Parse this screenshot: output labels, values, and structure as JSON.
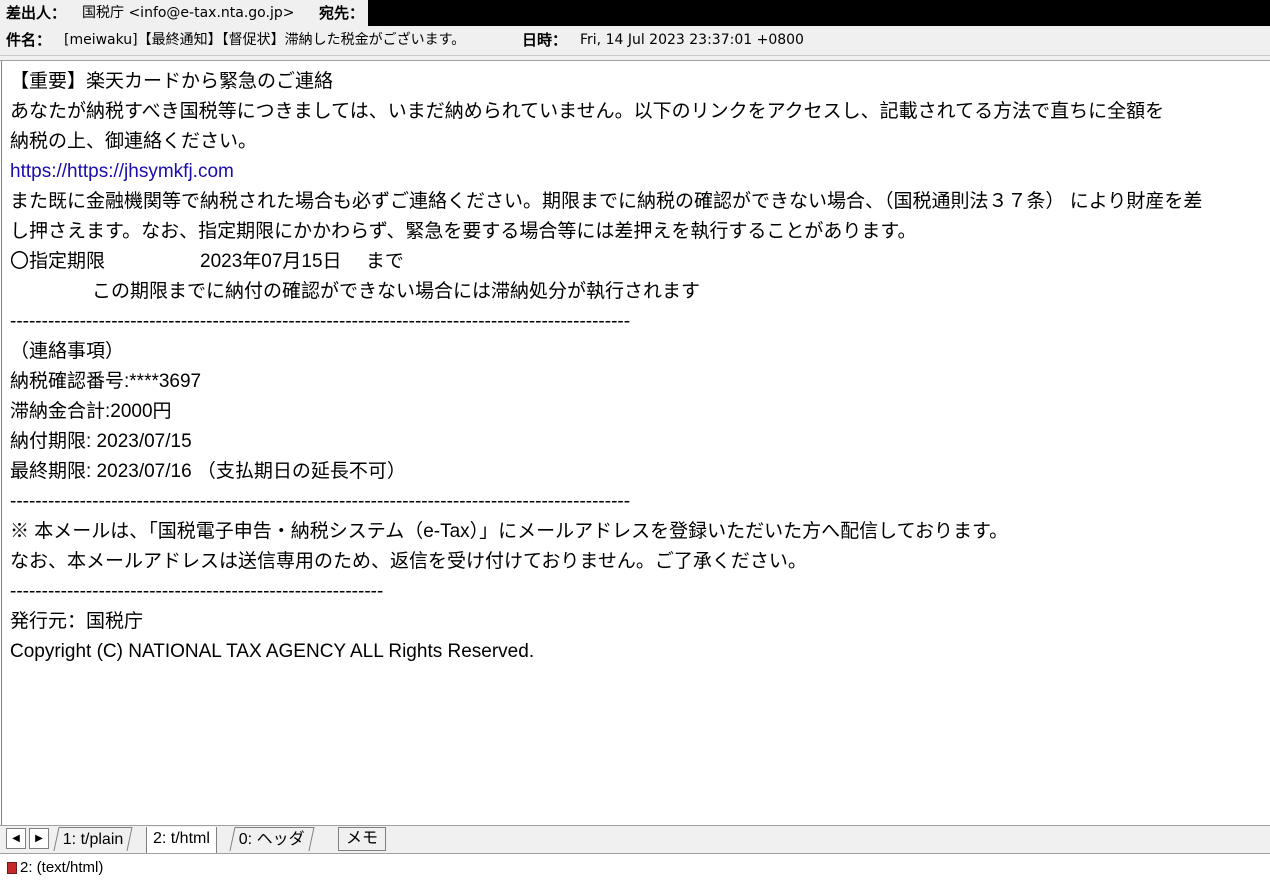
{
  "header": {
    "from_label": "差出人：",
    "from_value": "国税庁 <info@e-tax.nta.go.jp>",
    "to_label": "宛先：",
    "subject_label": "件名：",
    "subject_value": "[meiwaku]【最終通知】【督促状】滞納した税金がございます。",
    "date_label": "日時：",
    "date_value": "Fri, 14 Jul 2023 23:37:01 +0800"
  },
  "body": {
    "line1": "【重要】楽天カードから緊急のご連絡",
    "line2": "あなたが納税すべき国税等につきましては、いまだ納められていません。以下のリンクをアクセスし、記載されてる方法で直ちに全額を",
    "line3": "納税の上、御連絡ください。",
    "link": "https://https://jhsymkfj.com",
    "line5": "また既に金融機関等で納税された場合も必ずご連絡ください。期限までに納税の確認ができない場合、（国税通則法３７条） により財産を差",
    "line6": "し押さえます。なお、指定期限にかかわらず、緊急を要する場合等には差押えを執行することがあります。",
    "line7": "〇指定期限　　　　　2023年07月15日　 まで",
    "line8": "この期限までに納付の確認ができない場合には滞納処分が執行されます",
    "divider_long": "--------------------------------------------------------------------------------------------------",
    "line10": "（連絡事項）",
    "line11": "納税確認番号:****3697",
    "line12": "滞納金合計:2000円",
    "line13": "納付期限: 2023/07/15",
    "line14": "最終期限: 2023/07/16 （支払期日の延長不可）",
    "line16": "※ 本メールは、「国税電子申告・納税システム（e-Tax）」にメールアドレスを登録いただいた方へ配信しております。",
    "line17": "なお、本メールアドレスは送信専用のため、返信を受け付けておりません。ご了承ください。",
    "divider_short": "-----------------------------------------------------------",
    "line19": "発行元：国税庁",
    "line20": "Copyright (C) NATIONAL TAX AGENCY ALL Rights Reserved."
  },
  "tabs": {
    "prev_icon": "◀",
    "next_icon": "▶",
    "items": [
      {
        "label": "1: t/plain"
      },
      {
        "label": "2: t/html"
      },
      {
        "label": "0: ヘッダ"
      }
    ],
    "memo_label": "メモ"
  },
  "status": {
    "text": "2: (text/html)"
  }
}
